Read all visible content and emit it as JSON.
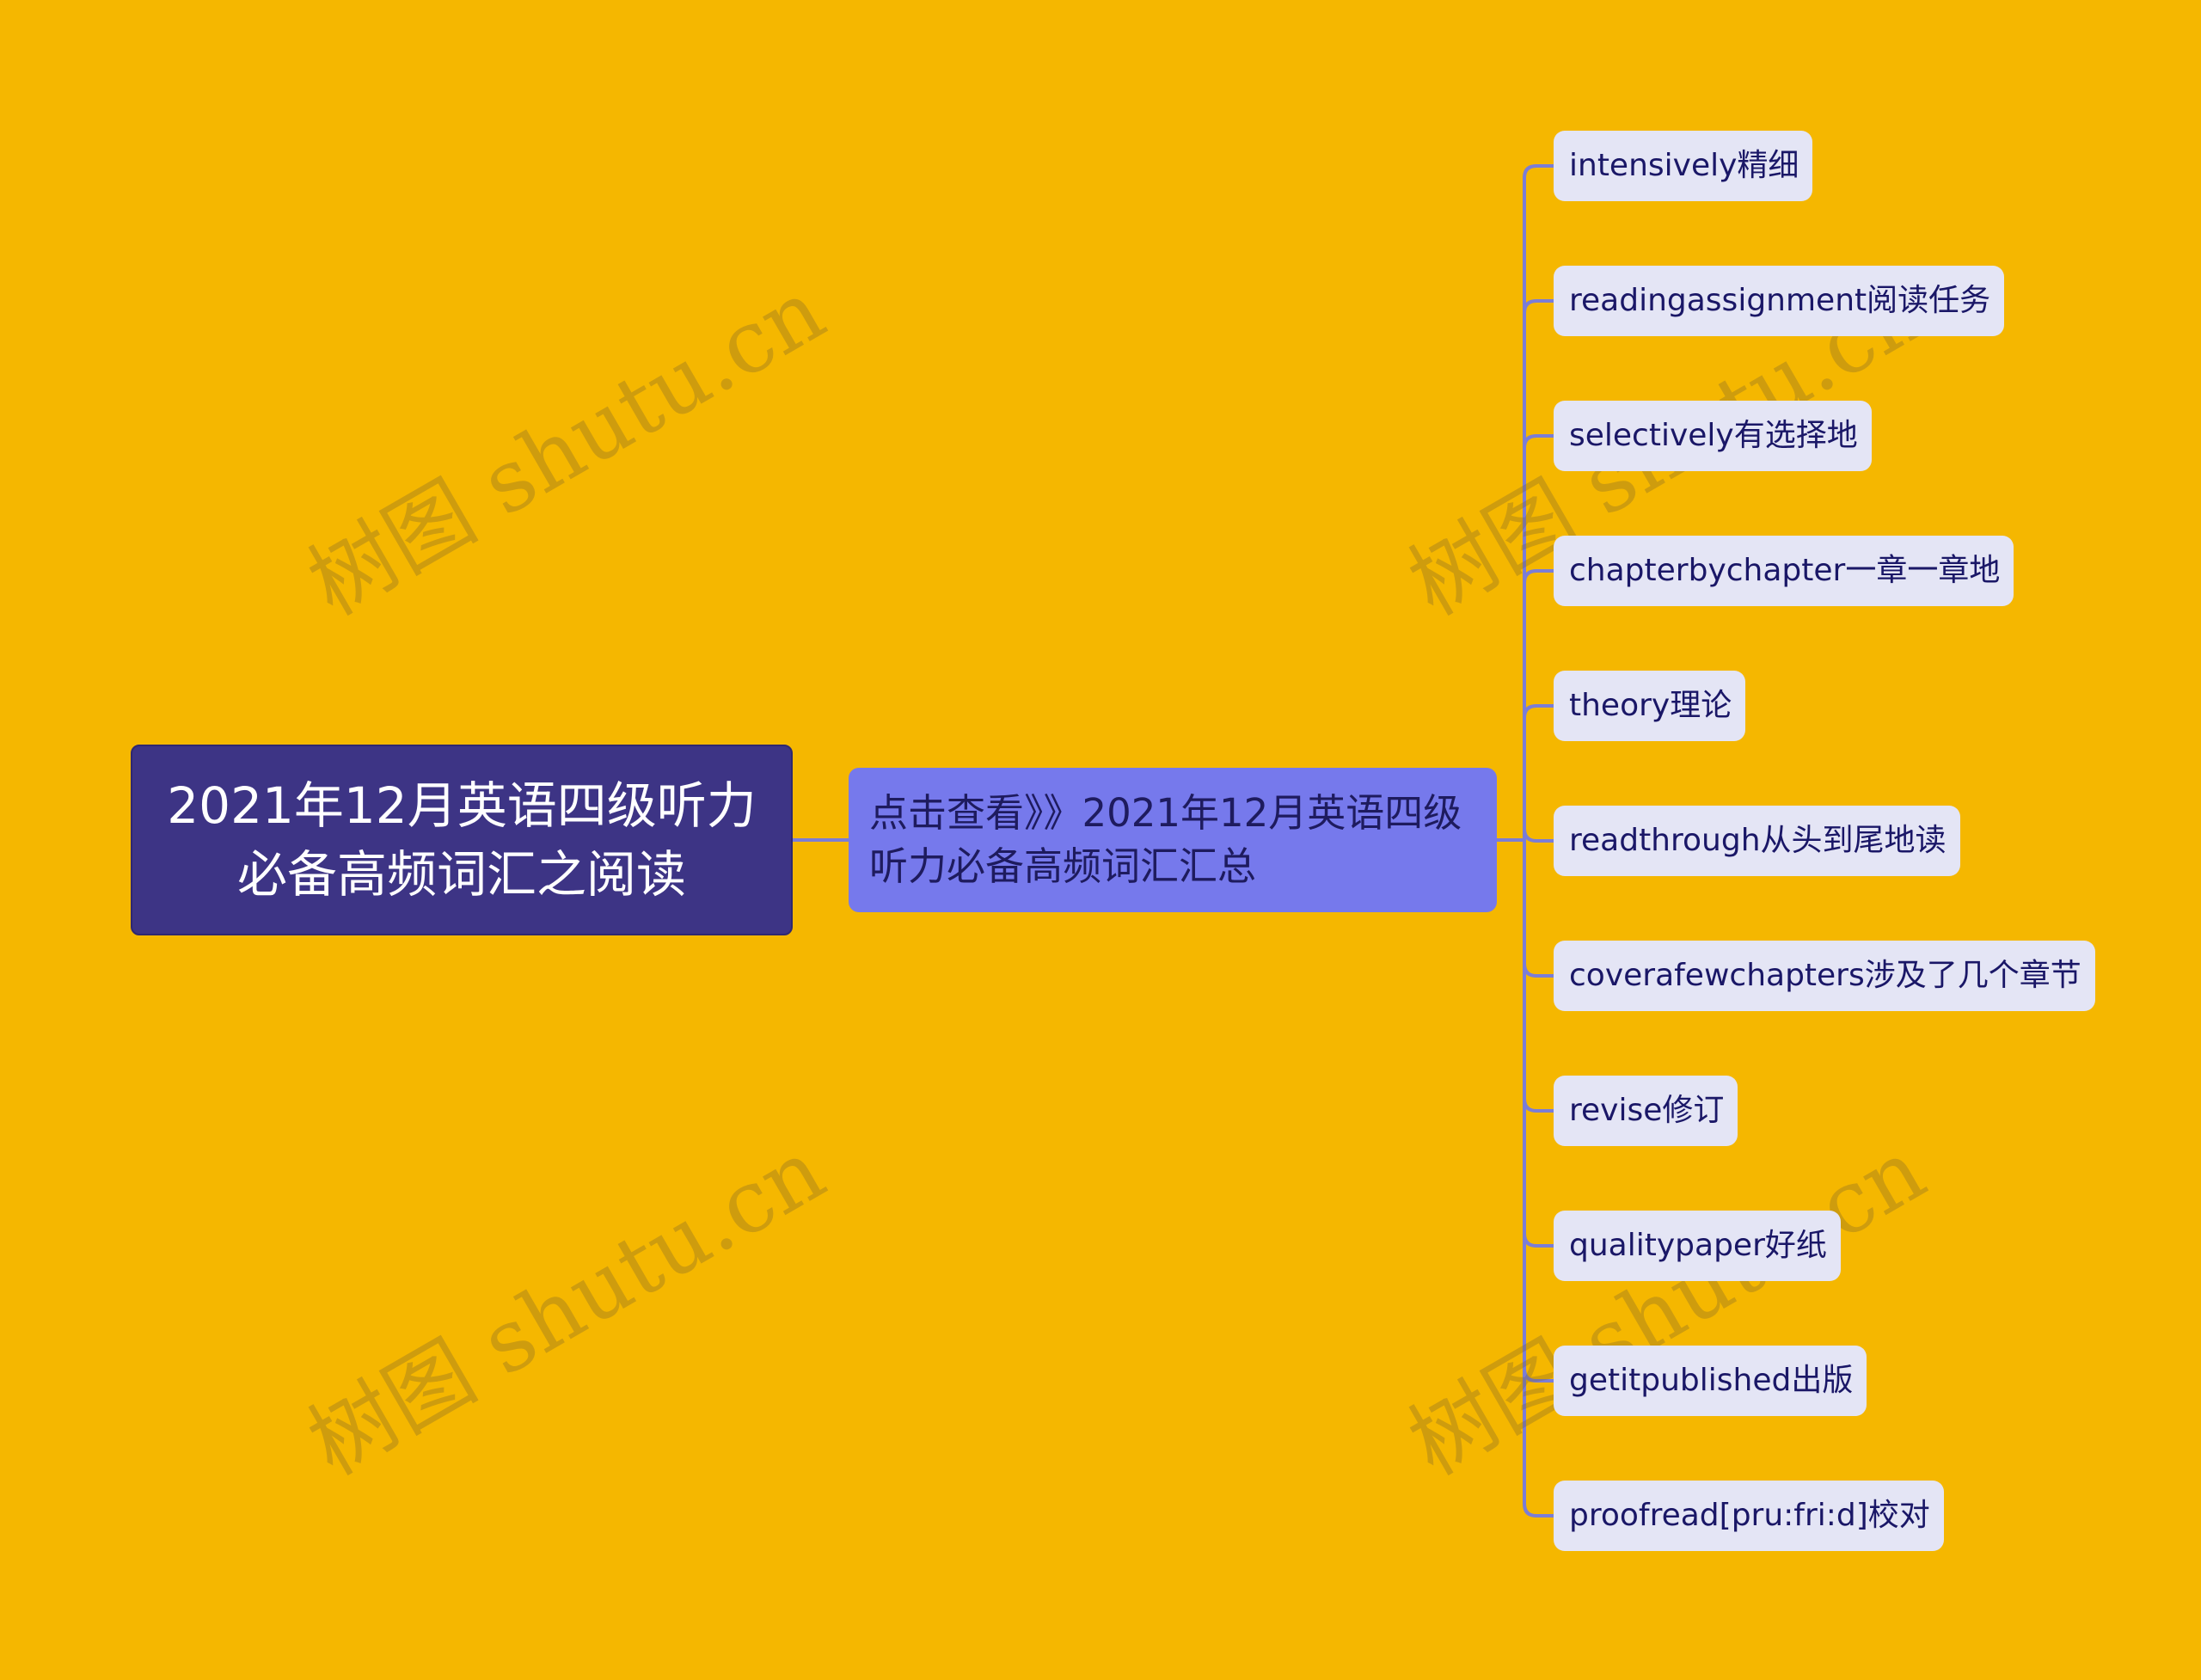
{
  "colors": {
    "background": "#F5B700",
    "root_fill": "#3D3485",
    "mid_fill": "#7679EC",
    "leaf_fill": "#E4E5F5",
    "connector": "#7B7DD6"
  },
  "root": {
    "label": "2021年12月英语四级听力必备高频词汇之阅读"
  },
  "branch": {
    "label": "点击查看》》2021年12月英语四级听力必备高频词汇汇总"
  },
  "leaves": [
    {
      "label": "intensively精细"
    },
    {
      "label": "readingassignment阅读任务"
    },
    {
      "label": "selectively有选择地"
    },
    {
      "label": "chapterbychapter一章一章地"
    },
    {
      "label": "theory理论"
    },
    {
      "label": "readthrough从头到尾地读"
    },
    {
      "label": "coverafewchapters涉及了几个章节"
    },
    {
      "label": "revise修订"
    },
    {
      "label": "qualitypaper好纸"
    },
    {
      "label": "getitpublished出版"
    },
    {
      "label": "proofread[pru:fri:d]校对"
    }
  ],
  "watermark": {
    "text": "树图 shutu.cn"
  }
}
